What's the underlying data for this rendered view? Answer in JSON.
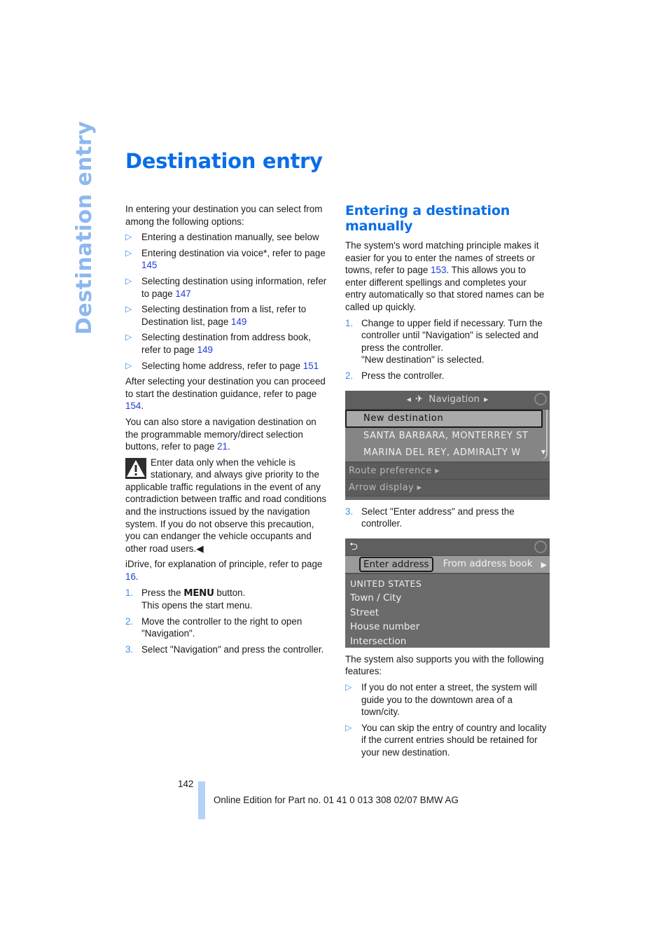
{
  "side_tab": "Destination entry",
  "title": "Destination entry",
  "left": {
    "intro": "In entering your destination you can select from among the following options:",
    "options": [
      {
        "text": "Entering a destination manually, see below",
        "page": ""
      },
      {
        "text": "Entering destination via voice*, refer to page ",
        "page": "145"
      },
      {
        "text": "Selecting destination using information, refer to page ",
        "page": "147"
      },
      {
        "text": "Selecting destination from a list, refer to Destination list, page ",
        "page": "149"
      },
      {
        "text": "Selecting destination from address book, refer to page ",
        "page": "149"
      },
      {
        "text": "Selecting home address, refer to page ",
        "page": "151"
      }
    ],
    "para_guidance": {
      "text": "After selecting your destination you can proceed to start the destination guidance, refer to page ",
      "page": "154",
      "end": "."
    },
    "para_store": {
      "text": "You can also store a navigation destination on the programmable memory/direct selection buttons, refer to page ",
      "page": "21",
      "end": "."
    },
    "warning": {
      "icon": "warning-triangle-icon",
      "text": "Enter data only when the vehicle is stationary, and always give priority to the applicable traffic regulations in the event of any contradiction between traffic and road conditions and the instructions issued by the navigation system. If you do not observe this precaution, you can endanger the vehicle occupants and other road users.",
      "end_mark": "◀"
    },
    "idrive": {
      "text": "iDrive, for explanation of principle, refer to page ",
      "page": "16",
      "end": "."
    },
    "steps": [
      {
        "num": "1.",
        "pre": "Press the ",
        "keyword": "MENU",
        "post": " button.",
        "sub": "This opens the start menu."
      },
      {
        "num": "2.",
        "text": "Move the controller to the right to open \"Navigation\"."
      },
      {
        "num": "3.",
        "text": "Select \"Navigation\" and press the controller."
      }
    ]
  },
  "right": {
    "heading": "Entering a destination manually",
    "intro": {
      "text": "The system's word matching principle makes it easier for you to enter the names of streets or towns, refer to page ",
      "page": "153",
      "end": ". This allows you to enter different spellings and completes your entry automatically so that stored names can be called up quickly."
    },
    "steps": [
      {
        "num": "1.",
        "text": "Change to upper field if necessary. Turn the controller until \"Navigation\" is selected and press the controller.",
        "sub": "\"New destination\" is selected."
      },
      {
        "num": "2.",
        "text": "Press the controller."
      },
      {
        "num": "3.",
        "text": "Select \"Enter address\" and press the controller."
      }
    ],
    "screen1": {
      "header": "Navigation",
      "items": [
        "New destination",
        "SANTA BARBARA, MONTERREY ST",
        "MARINA DEL REY, ADMIRALTY W"
      ],
      "sub_items": [
        "Route preference ▸",
        "Arrow display ▸"
      ]
    },
    "screen2": {
      "tabs": [
        "Enter address",
        "From address book"
      ],
      "items": [
        "UNITED STATES",
        "Town / City",
        "Street",
        "House number",
        "Intersection"
      ]
    },
    "features_intro": "The system also supports you with the following features:",
    "features": [
      "If you do not enter a street, the system will guide you to the downtown area of a town/city.",
      "You can skip the entry of country and locality if the current entries should be retained for your new destination."
    ]
  },
  "footer": {
    "page_number": "142",
    "edition": "Online Edition for Part no. 01 41 0 013 308 02/07 BMW AG"
  }
}
